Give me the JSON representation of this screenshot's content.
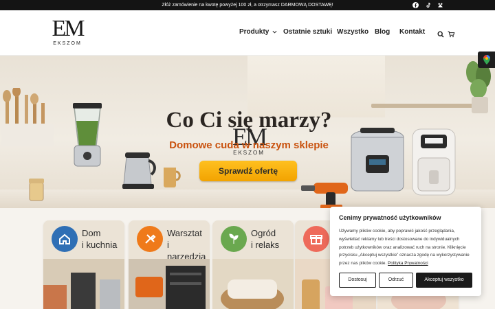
{
  "announcement": {
    "text": "Złóż zamówienie na kwotę powyżej 100 zł, a otrzymasz DARMOWĄ DOSTAWĘ!",
    "social": [
      "facebook-icon",
      "tiktok-icon",
      "groups-icon"
    ]
  },
  "brand": {
    "monogram": "EM",
    "wordmark": "EKSZOM"
  },
  "nav": {
    "items": [
      {
        "label": "Produkty",
        "dropdown": true
      },
      {
        "label": "Ostatnie sztuki"
      },
      {
        "label": "Wszystko"
      },
      {
        "label": "Blog"
      },
      {
        "label": "Kontakt"
      }
    ],
    "icons": [
      "search-icon",
      "cart-icon"
    ]
  },
  "hero": {
    "logo_monogram": "EM",
    "logo_wordmark": "EKSZOM",
    "title": "Co Ci się marzy?",
    "subtitle": "Domowe cuda w naszym sklepie",
    "cta": "Sprawdź ofertę"
  },
  "categories": [
    {
      "line1": "Dom",
      "line2": "i kuchnia",
      "color": "#2f6fb5",
      "icon": "house-icon"
    },
    {
      "line1": "Warsztat",
      "line2": "i narzędzia",
      "color": "#ef7a1a",
      "icon": "tools-icon"
    },
    {
      "line1": "Ogród",
      "line2": "i relaks",
      "color": "#6aa84f",
      "icon": "leaf-icon"
    },
    {
      "line1": "",
      "line2": "",
      "color": "#ee6a5a",
      "icon": "gift-icon"
    }
  ],
  "cookie": {
    "title": "Cenimy prywatność użytkowników",
    "text": "Używamy plików cookie, aby poprawić jakość przeglądania, wyświetlać reklamy lub treści dostosowane do indywidualnych potrzeb użytkowników oraz analizować ruch na stronie. Kliknięcie przycisku „Akceptuj wszystkie” oznacza zgodę na wykorzystywanie przez nas plików cookie.",
    "link": "Polityka Prywatności",
    "buttons": {
      "customize": "Dostosuj",
      "reject": "Odrzuć",
      "accept": "Akceptuj wszystko"
    }
  },
  "colors": {
    "topbar": "#141414",
    "cta": "#f2a300",
    "subtitle": "#c9520e",
    "cookie_primary": "#1b1b1b"
  }
}
